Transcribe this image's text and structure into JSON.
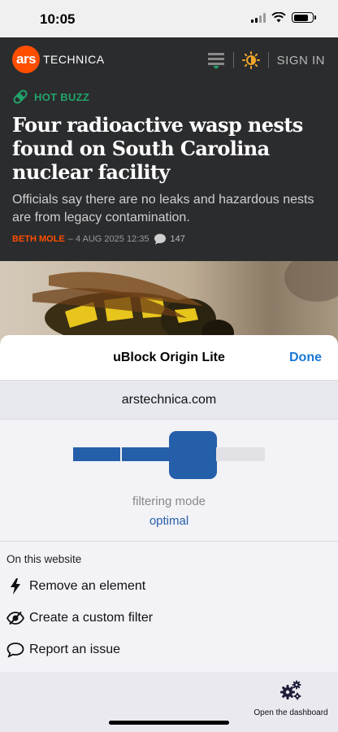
{
  "status_bar": {
    "time": "10:05"
  },
  "site_header": {
    "logo_ars": "ars",
    "logo_technica": "TECHNICA",
    "sign_in": "SIGN IN"
  },
  "article": {
    "tag": "HOT BUZZ",
    "headline": "Four radioactive wasp nests found on South Carolina nuclear facility",
    "dek": "Officials say there are no leaks and hazardous nests are from legacy contamination.",
    "author": "BETH MOLE",
    "date": "– 4 AUG 2025 12:35",
    "comments": "147"
  },
  "sheet": {
    "title": "uBlock Origin Lite",
    "done": "Done",
    "domain": "arstechnica.com",
    "filtering_mode_label": "filtering mode",
    "filtering_mode_value": "optimal",
    "filtering_level": "3 of 4",
    "on_site_title": "On this website",
    "actions": [
      {
        "label": "Remove an element",
        "icon": "lightning-icon"
      },
      {
        "label": "Create a custom filter",
        "icon": "eye-slash-icon"
      },
      {
        "label": "Report an issue",
        "icon": "comment-icon"
      }
    ],
    "dashboard_label": "Open the dashboard"
  },
  "colors": {
    "ars_orange": "#ff4e00",
    "hot_green": "#22a36a",
    "ublock_blue": "#255fa9",
    "ios_link_blue": "#1a7ad7"
  }
}
